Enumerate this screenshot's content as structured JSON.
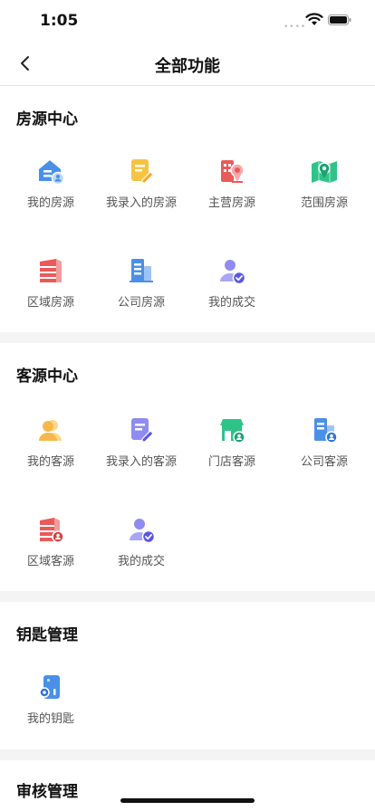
{
  "status": {
    "time": "1:05"
  },
  "header": {
    "title": "全部功能"
  },
  "sections": [
    {
      "title": "房源中心",
      "items": [
        {
          "label": "我的房源",
          "icon": "house-user-icon"
        },
        {
          "label": "我录入的房源",
          "icon": "note-edit-icon"
        },
        {
          "label": "主营房源",
          "icon": "building-pin-icon"
        },
        {
          "label": "范围房源",
          "icon": "map-pin-icon"
        },
        {
          "label": "区域房源",
          "icon": "stacked-building-icon"
        },
        {
          "label": "公司房源",
          "icon": "office-building-icon"
        },
        {
          "label": "我的成交",
          "icon": "person-check-icon"
        }
      ]
    },
    {
      "title": "客源中心",
      "items": [
        {
          "label": "我的客源",
          "icon": "person-card-icon"
        },
        {
          "label": "我录入的客源",
          "icon": "note-edit-icon"
        },
        {
          "label": "门店客源",
          "icon": "store-icon"
        },
        {
          "label": "公司客源",
          "icon": "office-user-icon"
        },
        {
          "label": "区域客源",
          "icon": "stacked-building-user-icon"
        },
        {
          "label": "我的成交",
          "icon": "person-check-icon"
        }
      ]
    },
    {
      "title": "钥匙管理",
      "items": [
        {
          "label": "我的钥匙",
          "icon": "key-card-icon"
        }
      ]
    },
    {
      "title": "审核管理",
      "items": []
    }
  ],
  "colors": {
    "blue": "#4a90e8",
    "yellow": "#f6c343",
    "red": "#ea5a5a",
    "green": "#2fc38a",
    "purple": "#8e8cf0",
    "orange": "#f7b84b"
  }
}
